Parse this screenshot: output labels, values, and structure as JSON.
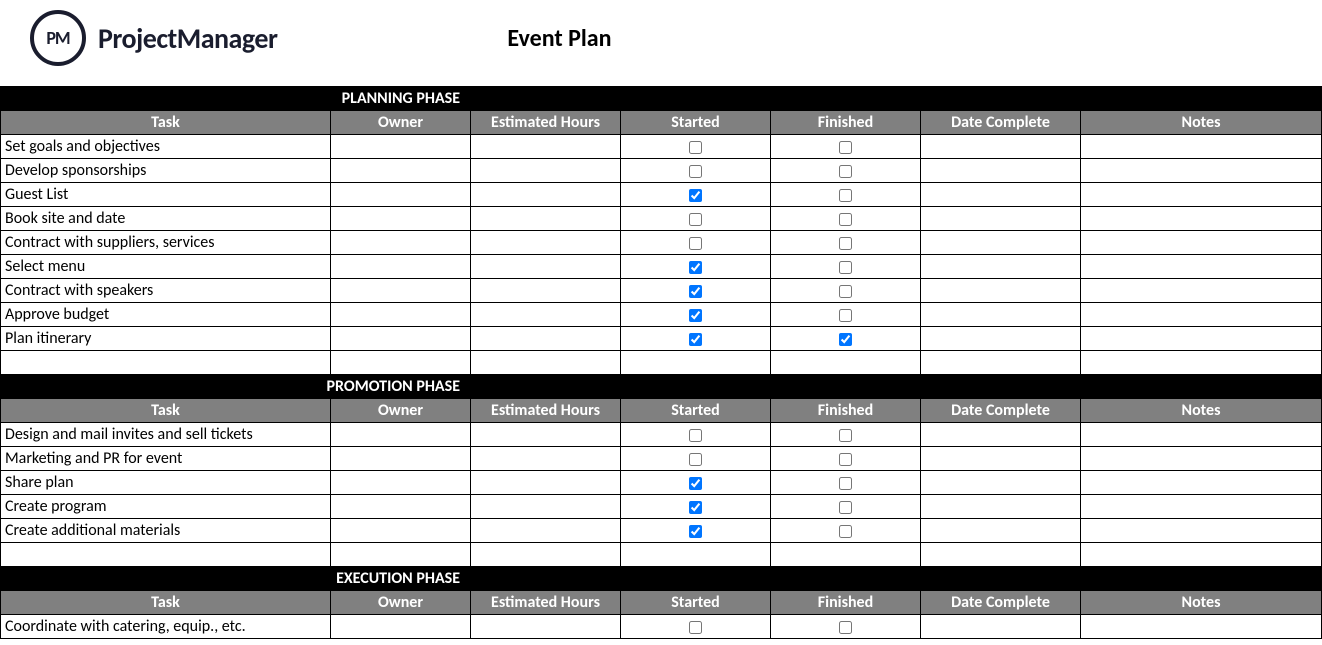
{
  "branding": {
    "logo_initials": "PM",
    "logo_name": "ProjectManager"
  },
  "document_title": "Event Plan",
  "columns": {
    "task": "Task",
    "owner": "Owner",
    "estimated_hours": "Estimated Hours",
    "started": "Started",
    "finished": "Finished",
    "date_complete": "Date Complete",
    "notes": "Notes"
  },
  "phases": [
    {
      "name": "PLANNING PHASE",
      "rows": [
        {
          "task": "Set goals and objectives",
          "owner": "",
          "estimated_hours": "",
          "started": false,
          "finished": false,
          "date_complete": "",
          "notes": ""
        },
        {
          "task": "Develop sponsorships",
          "owner": "",
          "estimated_hours": "",
          "started": false,
          "finished": false,
          "date_complete": "",
          "notes": ""
        },
        {
          "task": "Guest List",
          "owner": "",
          "estimated_hours": "",
          "started": true,
          "finished": false,
          "date_complete": "",
          "notes": ""
        },
        {
          "task": "Book site and date",
          "owner": "",
          "estimated_hours": "",
          "started": false,
          "finished": false,
          "date_complete": "",
          "notes": ""
        },
        {
          "task": "Contract with suppliers, services",
          "owner": "",
          "estimated_hours": "",
          "started": false,
          "finished": false,
          "date_complete": "",
          "notes": ""
        },
        {
          "task": "Select menu",
          "owner": "",
          "estimated_hours": "",
          "started": true,
          "finished": false,
          "date_complete": "",
          "notes": ""
        },
        {
          "task": "Contract with speakers",
          "owner": "",
          "estimated_hours": "",
          "started": true,
          "finished": false,
          "date_complete": "",
          "notes": ""
        },
        {
          "task": "Approve budget",
          "owner": "",
          "estimated_hours": "",
          "started": true,
          "finished": false,
          "date_complete": "",
          "notes": ""
        },
        {
          "task": "Plan itinerary",
          "owner": "",
          "estimated_hours": "",
          "started": true,
          "finished": true,
          "date_complete": "",
          "notes": ""
        },
        {
          "task": "",
          "owner": "",
          "estimated_hours": "",
          "started": null,
          "finished": null,
          "date_complete": "",
          "notes": ""
        }
      ]
    },
    {
      "name": "PROMOTION PHASE",
      "rows": [
        {
          "task": "Design and mail invites and sell tickets",
          "owner": "",
          "estimated_hours": "",
          "started": false,
          "finished": false,
          "date_complete": "",
          "notes": ""
        },
        {
          "task": "Marketing and PR for event",
          "owner": "",
          "estimated_hours": "",
          "started": false,
          "finished": false,
          "date_complete": "",
          "notes": ""
        },
        {
          "task": "Share plan",
          "owner": "",
          "estimated_hours": "",
          "started": true,
          "finished": false,
          "date_complete": "",
          "notes": ""
        },
        {
          "task": "Create program",
          "owner": "",
          "estimated_hours": "",
          "started": true,
          "finished": false,
          "date_complete": "",
          "notes": ""
        },
        {
          "task": "Create additional materials",
          "owner": "",
          "estimated_hours": "",
          "started": true,
          "finished": false,
          "date_complete": "",
          "notes": ""
        },
        {
          "task": "",
          "owner": "",
          "estimated_hours": "",
          "started": null,
          "finished": null,
          "date_complete": "",
          "notes": ""
        }
      ]
    },
    {
      "name": "EXECUTION PHASE",
      "rows": [
        {
          "task": "Coordinate with catering, equip., etc.",
          "owner": "",
          "estimated_hours": "",
          "started": false,
          "finished": false,
          "date_complete": "",
          "notes": ""
        }
      ]
    }
  ]
}
